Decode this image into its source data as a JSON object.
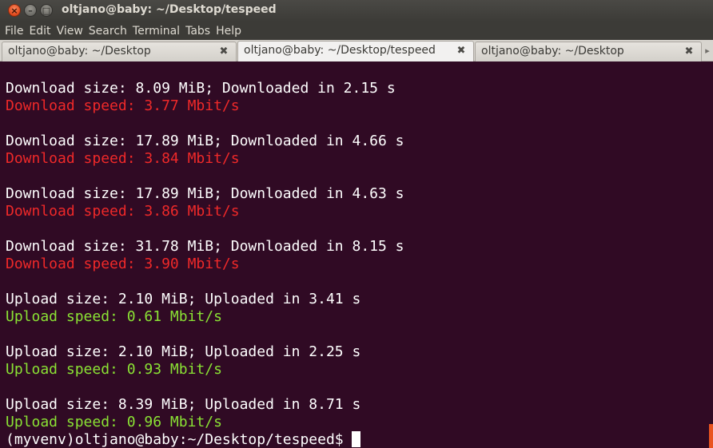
{
  "window": {
    "title": "oltjano@baby: ~/Desktop/tespeed",
    "close_glyph": "×",
    "minimize_glyph": "–",
    "maximize_glyph": "□"
  },
  "menu": [
    "File",
    "Edit",
    "View",
    "Search",
    "Terminal",
    "Tabs",
    "Help"
  ],
  "tabs": [
    {
      "label": "oltjano@baby: ~/Desktop",
      "active": false
    },
    {
      "label": "oltjano@baby: ~/Desktop/tespeed",
      "active": true
    },
    {
      "label": "oltjano@baby: ~/Desktop",
      "active": false
    }
  ],
  "tab_close_glyph": "✖",
  "colors": {
    "terminal_bg": "#300a24",
    "text": "#ffffff",
    "download_speed": "#ef2929",
    "upload_speed": "#8ae234",
    "accent": "#e95420"
  },
  "terminal": {
    "lines": [
      {
        "text": "Download size: 8.09 MiB; Downloaded in 2.15 s",
        "color": "white"
      },
      {
        "text": "Download speed: 3.77 Mbit/s",
        "color": "red"
      },
      {
        "text": "Download size: 17.89 MiB; Downloaded in 4.66 s",
        "color": "white"
      },
      {
        "text": "Download speed: 3.84 Mbit/s",
        "color": "red"
      },
      {
        "text": "Download size: 17.89 MiB; Downloaded in 4.63 s",
        "color": "white"
      },
      {
        "text": "Download speed: 3.86 Mbit/s",
        "color": "red"
      },
      {
        "text": "Download size: 31.78 MiB; Downloaded in 8.15 s",
        "color": "white"
      },
      {
        "text": "Download speed: 3.90 Mbit/s",
        "color": "red"
      },
      {
        "text": "Upload size: 2.10 MiB; Uploaded in 3.41 s",
        "color": "white"
      },
      {
        "text": "Upload speed: 0.61 Mbit/s",
        "color": "green"
      },
      {
        "text": "Upload size: 2.10 MiB; Uploaded in 2.25 s",
        "color": "white"
      },
      {
        "text": "Upload speed: 0.93 Mbit/s",
        "color": "green"
      },
      {
        "text": "Upload size: 8.39 MiB; Uploaded in 8.71 s",
        "color": "white"
      },
      {
        "text": "Upload speed: 0.96 Mbit/s",
        "color": "green"
      }
    ],
    "prompt": "(myvenv)oltjano@baby:~/Desktop/tespeed$"
  }
}
